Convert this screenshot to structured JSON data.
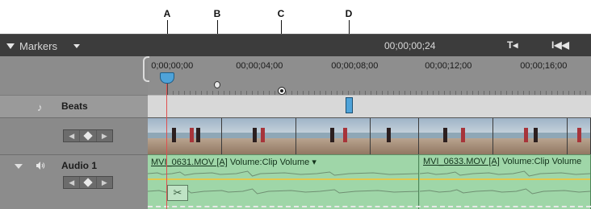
{
  "callouts": [
    "A",
    "B",
    "C",
    "D"
  ],
  "header": {
    "panel_title": "Markers",
    "timecode": "00;00;00;24",
    "icons": [
      "set-in-marker-icon",
      "go-to-start-icon"
    ]
  },
  "ruler": {
    "labels": [
      "0;00;00;00",
      "00;00;04;00",
      "00;00;08;00",
      "00;00;12;00",
      "00;00;16;00"
    ]
  },
  "tracks": {
    "beats": {
      "label": "Beats"
    },
    "audio": {
      "label": "Audio 1",
      "clips": [
        {
          "filename": "MVI_0631.MOV [A]",
          "effect": "Volume:Clip Volume"
        },
        {
          "filename": "MVI_0633.MOV [A]",
          "effect": "Volume:Clip Volume"
        }
      ]
    }
  },
  "colors": {
    "header_bg": "#3c3c3c",
    "cti": "#4fa3d9",
    "audio_clip": "#9fd6a8",
    "volume_line": "#e3c84b"
  }
}
